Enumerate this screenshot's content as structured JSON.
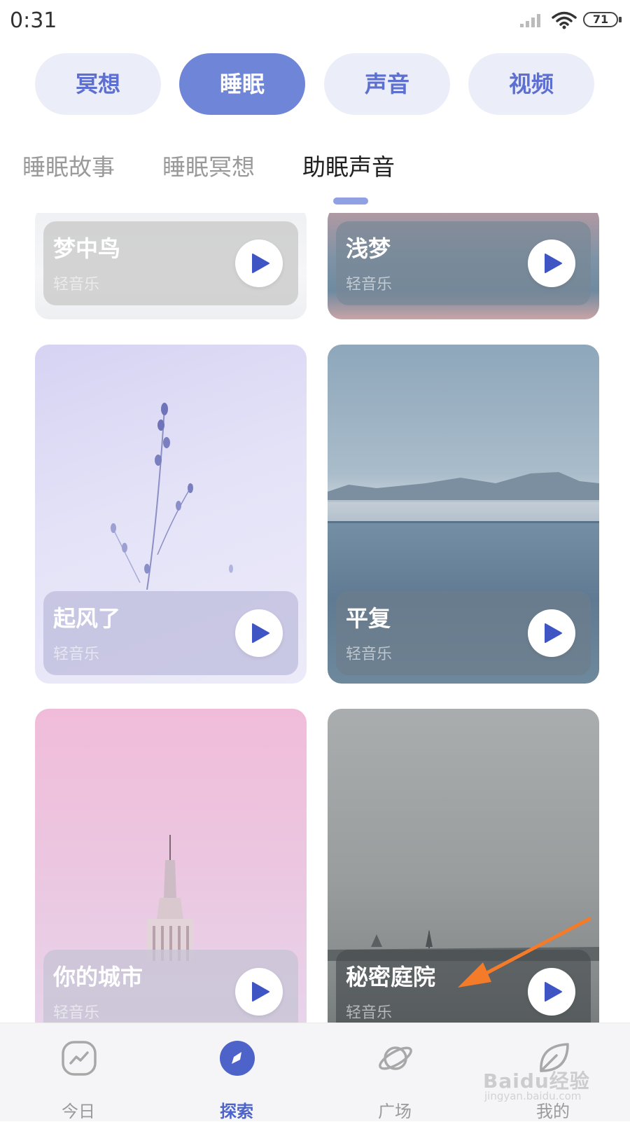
{
  "status_bar": {
    "time": "0:31",
    "battery": "71"
  },
  "categories": [
    {
      "label": "冥想",
      "active": false
    },
    {
      "label": "睡眠",
      "active": true
    },
    {
      "label": "声音",
      "active": false
    },
    {
      "label": "视频",
      "active": false
    }
  ],
  "subtabs": [
    {
      "label": "睡眠故事",
      "active": false
    },
    {
      "label": "睡眠冥想",
      "active": false
    },
    {
      "label": "助眠声音",
      "active": true
    }
  ],
  "cards": [
    {
      "title": "梦中鸟",
      "subtitle": "轻音乐"
    },
    {
      "title": "浅梦",
      "subtitle": "轻音乐"
    },
    {
      "title": "起风了",
      "subtitle": "轻音乐"
    },
    {
      "title": "平复",
      "subtitle": "轻音乐"
    },
    {
      "title": "你的城市",
      "subtitle": "轻音乐"
    },
    {
      "title": "秘密庭院",
      "subtitle": "轻音乐"
    }
  ],
  "bottom_nav": [
    {
      "label": "今日",
      "icon": "trend-chart-icon",
      "active": false
    },
    {
      "label": "探索",
      "icon": "compass-icon",
      "active": true
    },
    {
      "label": "广场",
      "icon": "planet-icon",
      "active": false
    },
    {
      "label": "我的",
      "icon": "leaf-icon",
      "active": false
    }
  ],
  "watermark": {
    "text": "Baidu经验",
    "sub": "jingyan.baidu.com"
  },
  "colors": {
    "accent": "#6f86d8",
    "active_nav": "#4d63c9",
    "chip_bg": "#ebedf9",
    "arrow": "#f47b2a"
  }
}
